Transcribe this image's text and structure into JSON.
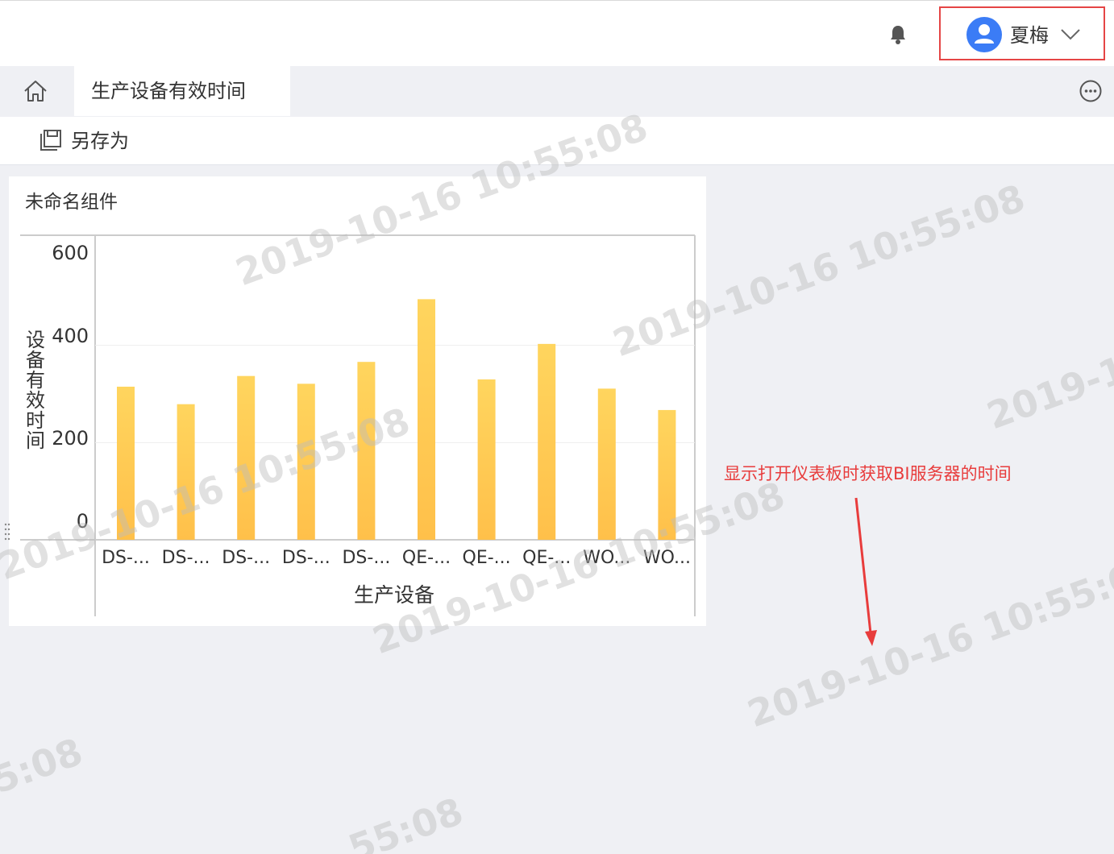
{
  "header": {
    "user_name": "夏梅",
    "icons": {
      "bell": "bell-icon",
      "avatar": "user-icon",
      "caret": "chevron-down-icon"
    }
  },
  "tabs": {
    "home_icon": "home-icon",
    "active_tab": "生产设备有效时间",
    "more_icon": "more-icon"
  },
  "toolbar": {
    "save_as_label": "另存为",
    "save_icon": "save-icon"
  },
  "widget": {
    "title": "未命名组件"
  },
  "chart_data": {
    "type": "bar",
    "title": "",
    "xlabel": "生产设备",
    "ylabel": "设备有效时间",
    "ylim": [
      0,
      600
    ],
    "yticks": [
      "600",
      "400",
      "200",
      "0"
    ],
    "categories": [
      "DS-...",
      "DS-...",
      "DS-...",
      "DS-...",
      "DS-...",
      "QE-...",
      "QE-...",
      "QE-...",
      "WO...",
      "WO..."
    ],
    "values": [
      315,
      279,
      337,
      321,
      366,
      495,
      330,
      403,
      311,
      267
    ],
    "bar_color_top": "#ffd55e",
    "bar_color_bottom": "#ffc04a",
    "grid": true
  },
  "watermark": {
    "text": "2019-10-16 10:55:08",
    "partials": [
      "2019-10",
      "5:08",
      "55:08"
    ]
  },
  "annotation": {
    "text": "显示打开仪表板时获取BI服务器的时间",
    "color": "#e83c3c"
  }
}
